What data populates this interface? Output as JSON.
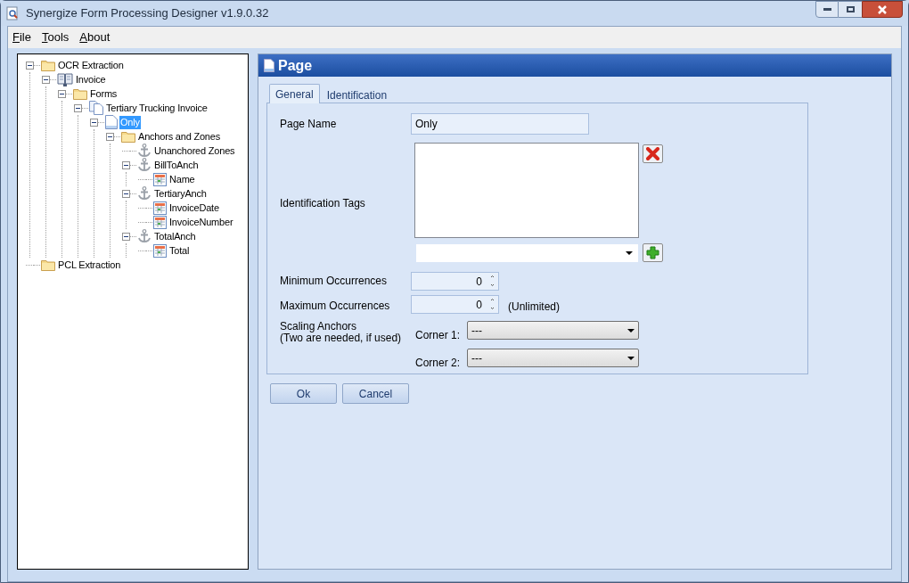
{
  "window": {
    "title": "Synergize Form Processing Designer v1.9.0.32"
  },
  "menu": [
    {
      "label": "File"
    },
    {
      "label": "Tools"
    },
    {
      "label": "About"
    }
  ],
  "tree": [
    {
      "label": "OCR Extraction",
      "kind": "folder",
      "selected": false,
      "expanded": true,
      "children": [
        {
          "label": "Invoice",
          "kind": "book",
          "selected": false,
          "expanded": true,
          "children": [
            {
              "label": "Forms",
              "kind": "folder",
              "selected": false,
              "expanded": true,
              "children": [
                {
                  "label": "Tertiary Trucking Invoice",
                  "kind": "pages",
                  "selected": false,
                  "expanded": true,
                  "children": [
                    {
                      "label": "Only",
                      "kind": "page",
                      "selected": true,
                      "expanded": true,
                      "children": [
                        {
                          "label": "Anchors and Zones",
                          "kind": "folder",
                          "selected": false,
                          "expanded": true,
                          "children": [
                            {
                              "label": "Unanchored Zones",
                              "kind": "anchor",
                              "selected": false
                            },
                            {
                              "label": "BillToAnch",
                              "kind": "anchor",
                              "selected": false,
                              "expanded": true,
                              "children": [
                                {
                                  "label": "Name",
                                  "kind": "zone",
                                  "selected": false
                                }
                              ]
                            },
                            {
                              "label": "TertiaryAnch",
                              "kind": "anchor",
                              "selected": false,
                              "expanded": true,
                              "children": [
                                {
                                  "label": "InvoiceDate",
                                  "kind": "zone",
                                  "selected": false
                                },
                                {
                                  "label": "InvoiceNumber",
                                  "kind": "zone",
                                  "selected": false
                                }
                              ]
                            },
                            {
                              "label": "TotalAnch",
                              "kind": "anchor",
                              "selected": false,
                              "expanded": true,
                              "children": [
                                {
                                  "label": "Total",
                                  "kind": "zone",
                                  "selected": false
                                }
                              ]
                            }
                          ]
                        }
                      ]
                    }
                  ]
                }
              ]
            }
          ]
        }
      ]
    },
    {
      "label": "PCL Extraction",
      "kind": "folder",
      "selected": false
    }
  ],
  "panel": {
    "title": "Page",
    "tabs": [
      {
        "label": "General",
        "selected": true
      },
      {
        "label": "Identification",
        "selected": false
      }
    ],
    "page_name": {
      "label": "Page Name",
      "value": "Only"
    },
    "identification_tags": {
      "label": "Identification Tags"
    },
    "minimum_occurrences": {
      "label": "Minimum Occurrences",
      "value": "0"
    },
    "maximum_occurrences": {
      "label": "Maximum Occurrences",
      "value": "0",
      "note": "(Unlimited)"
    },
    "scaling_anchors": {
      "label": "Scaling Anchors",
      "sublabel": "(Two are needed, if used)",
      "corners": [
        {
          "label": "Corner 1:",
          "value": "---"
        },
        {
          "label": "Corner 2:",
          "value": "---"
        }
      ]
    },
    "buttons": [
      "Ok",
      "Cancel"
    ]
  }
}
